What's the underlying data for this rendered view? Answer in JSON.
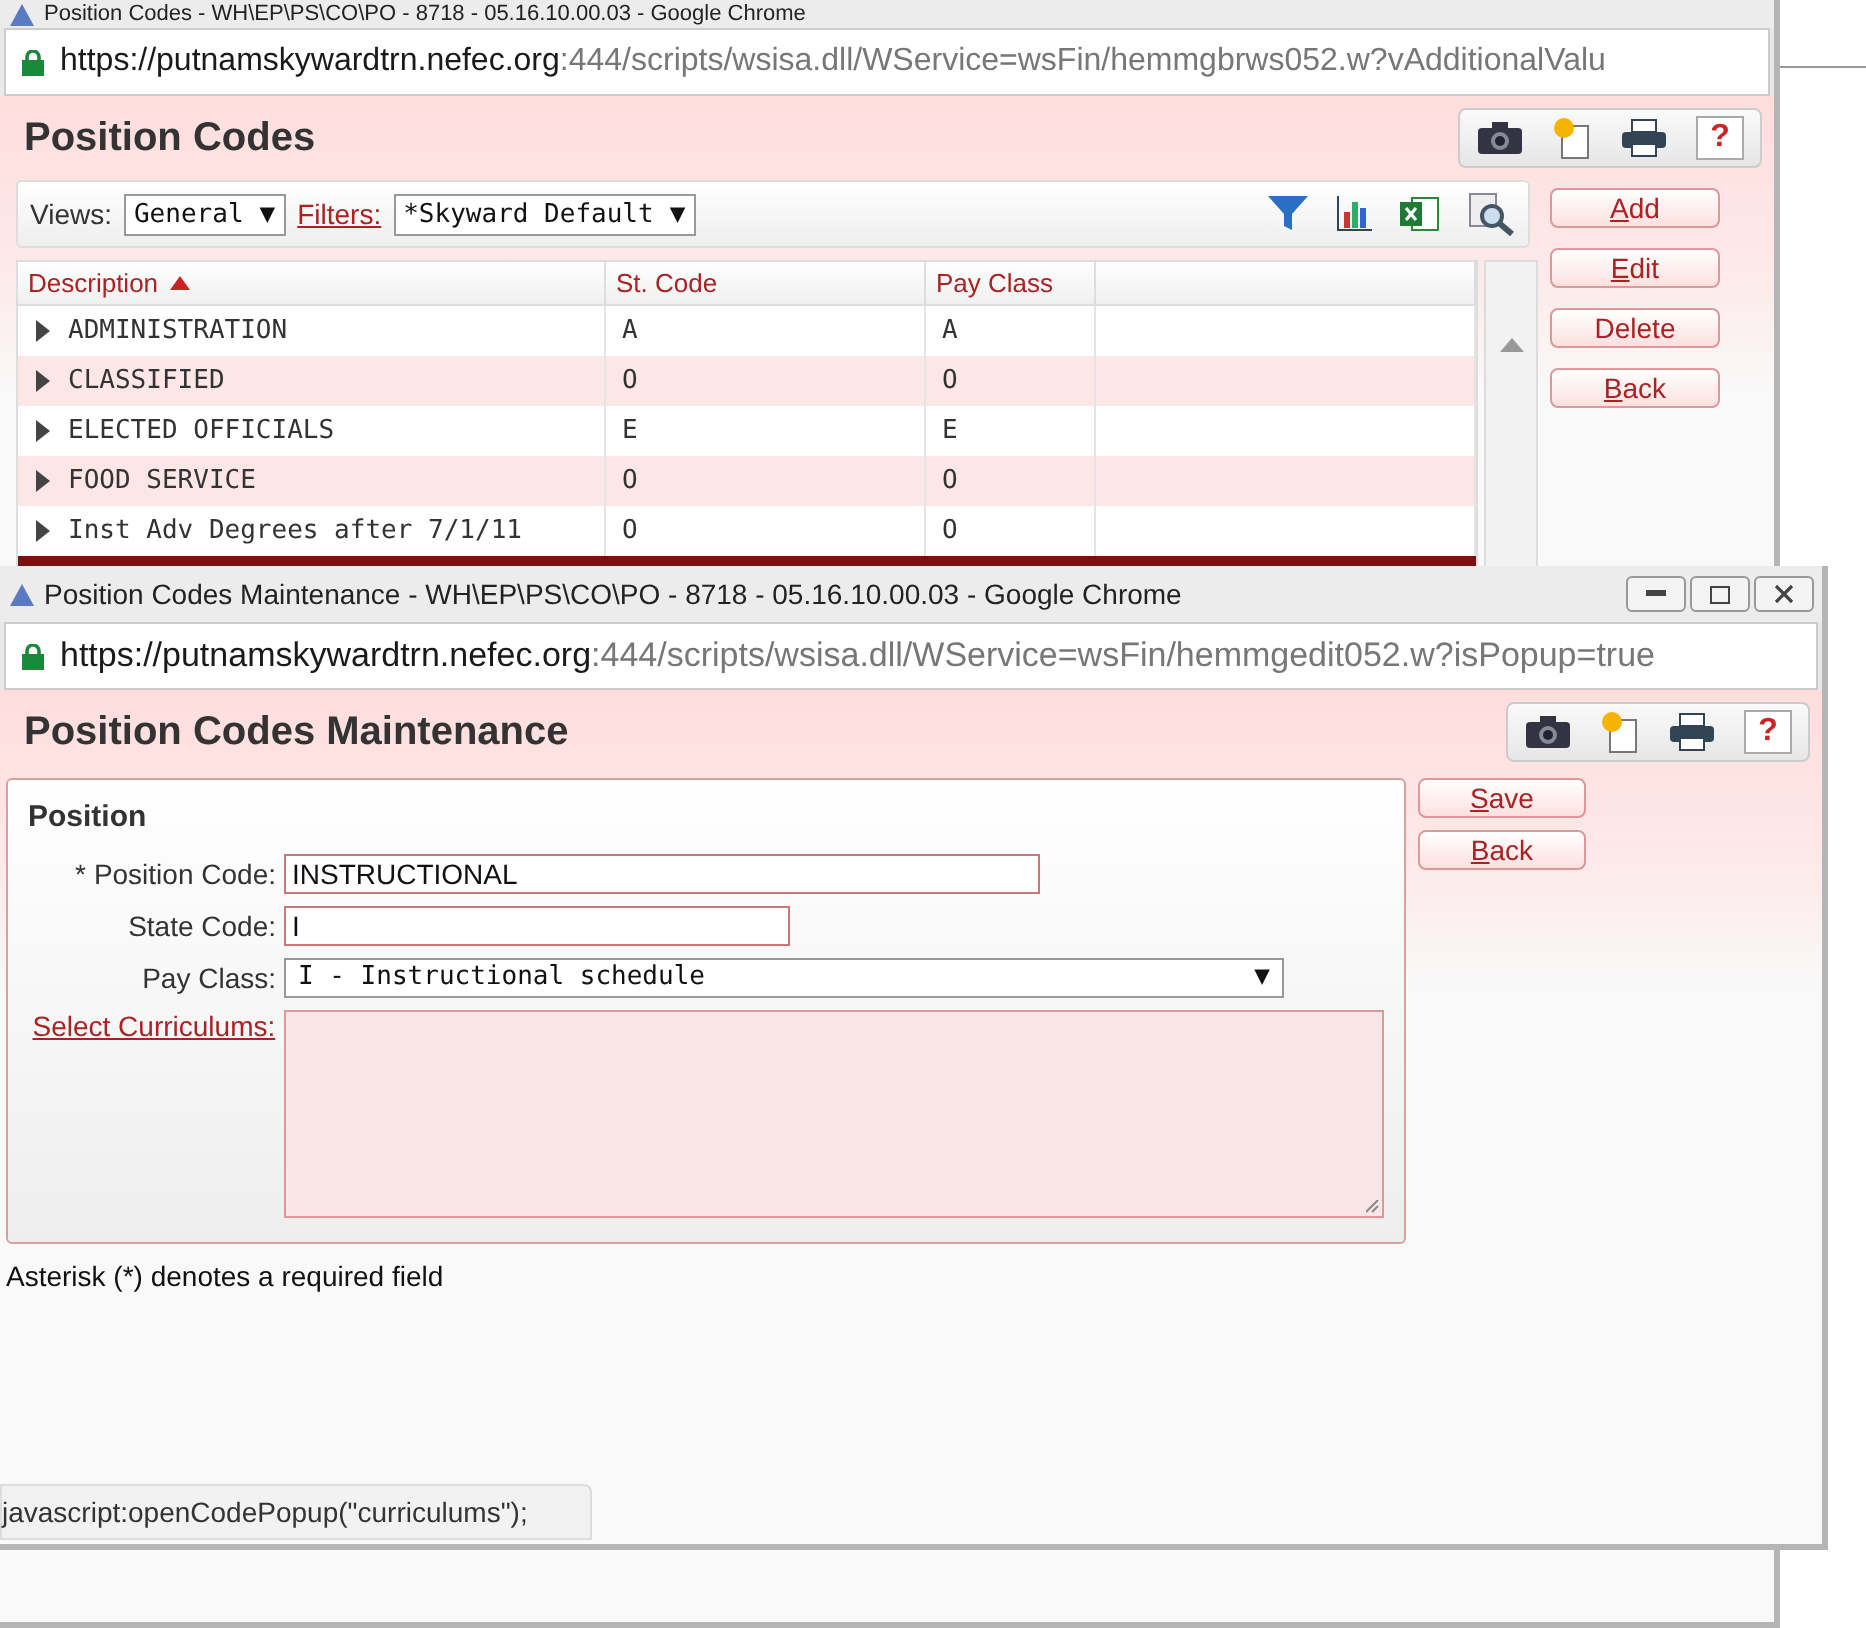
{
  "back_window": {
    "title": "Position Codes - WH\\EP\\PS\\CO\\PO - 8718 - 05.16.10.00.03 - Google Chrome",
    "url_host": "https://putnamskywardtrn.nefec.org",
    "url_path": ":444/scripts/wsisa.dll/WService=wsFin/hemmgbrws052.w?vAdditionalValu",
    "page_title": "Position Codes",
    "help": "?",
    "views_label": "Views:",
    "views_value": "General",
    "filters_label": "Filters:",
    "filters_value": "*Skyward Default",
    "dropdown_arrow": "▼",
    "columns": [
      {
        "label": "Description",
        "sorted_ascending": true
      },
      {
        "label": "St. Code",
        "sorted_ascending": false
      },
      {
        "label": "Pay Class",
        "sorted_ascending": false
      }
    ],
    "rows": [
      {
        "description": "ADMINISTRATION",
        "st_code": "A",
        "pay_class": "A",
        "expanded": false
      },
      {
        "description": "CLASSIFIED",
        "st_code": "O",
        "pay_class": "O",
        "expanded": false
      },
      {
        "description": "ELECTED OFFICIALS",
        "st_code": "E",
        "pay_class": "E",
        "expanded": false
      },
      {
        "description": "FOOD SERVICE",
        "st_code": "O",
        "pay_class": "O",
        "expanded": false
      },
      {
        "description": "Inst Adv Degrees after 7/1/11",
        "st_code": "O",
        "pay_class": "O",
        "expanded": false
      }
    ],
    "buttons": [
      {
        "label": "Add",
        "hotkey_first": true
      },
      {
        "label": "Edit",
        "hotkey_first": true
      },
      {
        "label": "Delete",
        "hotkey_first": false
      },
      {
        "label": "Back",
        "hotkey_first": true
      }
    ]
  },
  "popup": {
    "title": "Position Codes Maintenance - WH\\EP\\PS\\CO\\PO - 8718 - 05.16.10.00.03 - Google Chrome",
    "url_host": "https://putnamskywardtrn.nefec.org",
    "url_path": ":444/scripts/wsisa.dll/WService=wsFin/hemmgedit052.w?isPopup=true",
    "page_title": "Position Codes Maintenance",
    "help": "?",
    "section_title": "Position",
    "fields": [
      {
        "kind": "text",
        "label": "Position Code:",
        "required": true,
        "value": "INSTRUCTIONAL"
      },
      {
        "kind": "text",
        "label": "State Code:",
        "required": false,
        "value": "I"
      },
      {
        "kind": "select",
        "label": "Pay Class:",
        "required": false,
        "value": "I - Instructional schedule"
      },
      {
        "kind": "link-area",
        "label": "Select Curriculums:",
        "required": false
      }
    ],
    "required_mark": "*",
    "note": "Asterisk (*) denotes a required field",
    "buttons": [
      {
        "label": "Save",
        "hotkey_first": true
      },
      {
        "label": "Back",
        "hotkey_first": true
      }
    ],
    "status_text": "javascript:openCodePopup(\"curriculums\");"
  }
}
